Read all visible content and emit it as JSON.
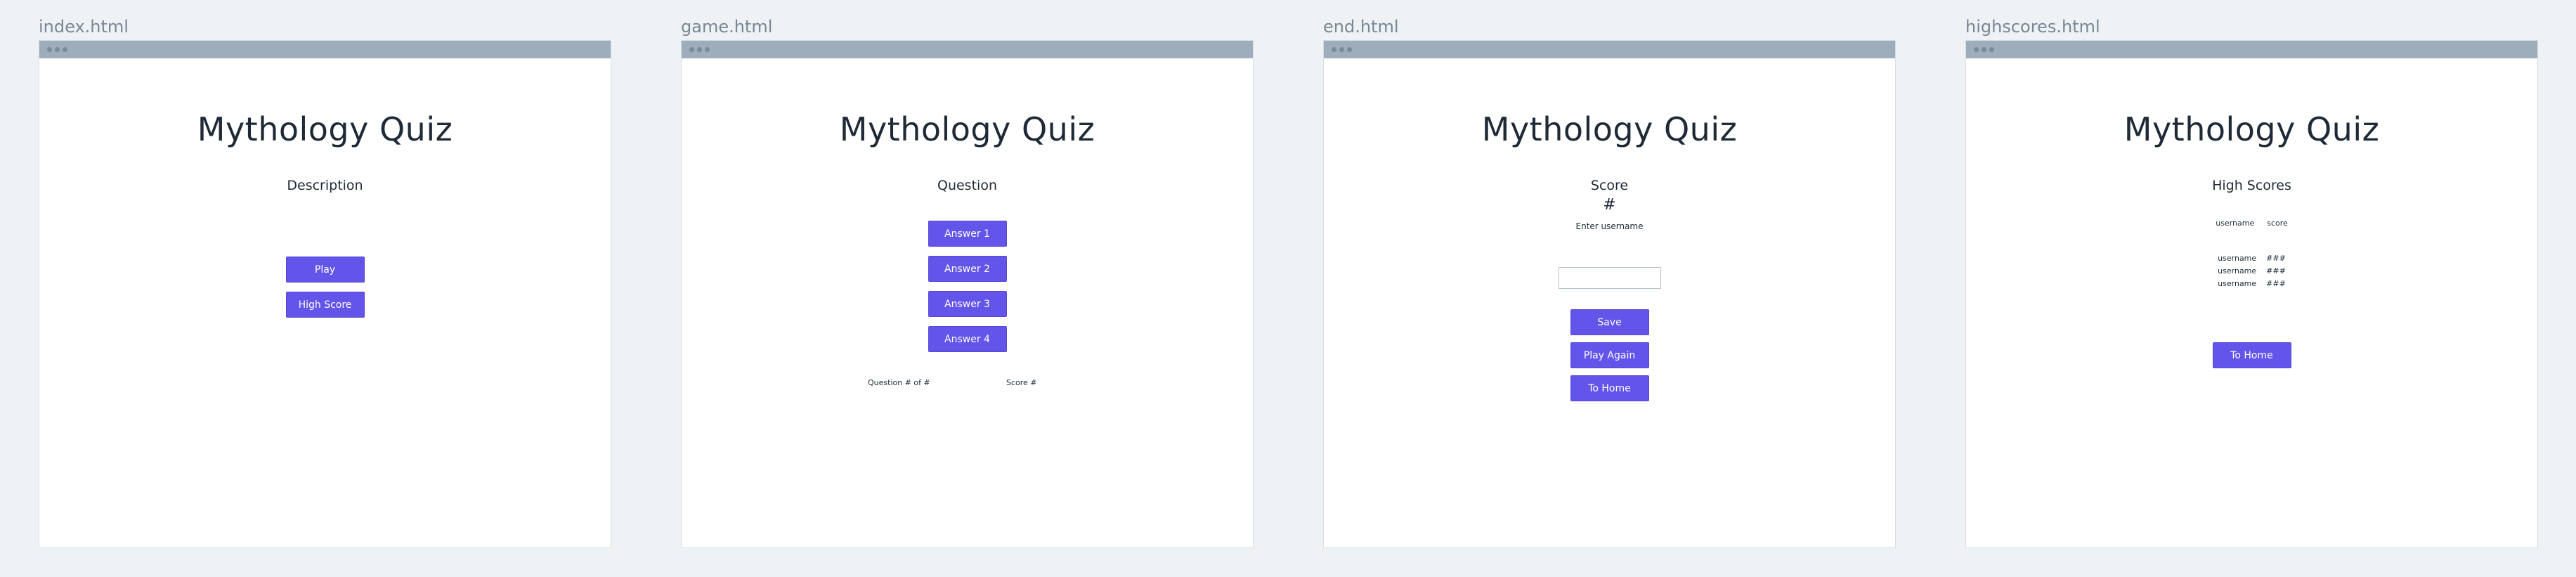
{
  "frames": [
    {
      "label": "index.html",
      "title": "Mythology Quiz",
      "subtitle": "Description",
      "buttons": [
        "Play",
        "High Score"
      ]
    },
    {
      "label": "game.html",
      "title": "Mythology Quiz",
      "subtitle": "Question",
      "buttons": [
        "Answer 1",
        "Answer 2",
        "Answer 3",
        "Answer 4"
      ],
      "progress_text": "Question # of #",
      "score_text": "Score #"
    },
    {
      "label": "end.html",
      "title": "Mythology Quiz",
      "subtitle": "Score",
      "score_value": "#",
      "input_label": "Enter username",
      "input_value": "",
      "input_placeholder": "",
      "buttons": [
        "Save",
        "Play Again",
        "To Home"
      ]
    },
    {
      "label": "highscores.html",
      "title": "Mythology Quiz",
      "subtitle": "High Scores",
      "table_headers": [
        "username",
        "score"
      ],
      "rows": [
        [
          "username",
          "###"
        ],
        [
          "username",
          "###"
        ],
        [
          "username",
          "###"
        ]
      ],
      "buttons": [
        "To Home"
      ]
    }
  ],
  "colors": {
    "button": "#6455ea",
    "titlebar": "#9eadbb",
    "background": "#eef2f5",
    "label": "#7a8794"
  }
}
